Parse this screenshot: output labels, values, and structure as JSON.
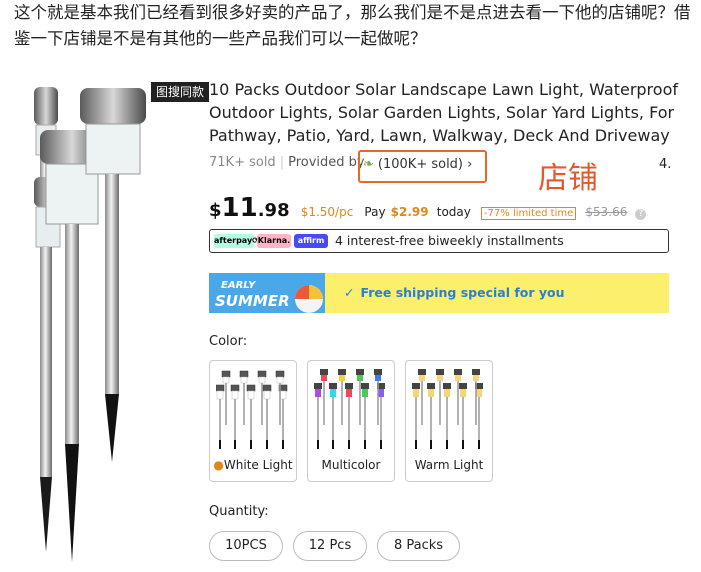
{
  "intro": {
    "text": "这个就是基本我们已经看到很多好卖的产品了，那么我们是不是点进去看一下他的店铺呢？借鉴一下店铺是不是有其他的一些产品我们可以一起做呢？"
  },
  "product": {
    "search_badge": "图搜同款",
    "title": "10 Packs Outdoor Solar Landscape Lawn Light, Waterproof Outdoor Lights, Solar Garden Lights, Solar Yard Lights, For Pathway, Patio, Yard, Lawn, Walkway, Deck And Driveway",
    "sold": "71K+ sold",
    "provided_by": "Provided by",
    "store_sold": "(100K+ sold)",
    "store_chevron": "›",
    "rating_partial": "4.",
    "annotation_label": "店铺"
  },
  "price": {
    "currency": "$",
    "whole": "11",
    "cents": ".98",
    "unit_price": "$1.50/pc",
    "pay_label": "Pay",
    "pay_amount": "$2.99",
    "today": "today",
    "discount": "-77% limited time",
    "original": "$53.66",
    "info_icon": "?"
  },
  "installments": {
    "afterpay": "afterpay⟳",
    "klarna": "Klarna.",
    "affirm": "affirm",
    "text": "4 interest-free biweekly installments"
  },
  "shipping": {
    "banner_line1": "EARLY",
    "banner_line2": "SUMMER",
    "check": "✓",
    "text": "Free shipping special for you"
  },
  "colors": {
    "label": "Color:",
    "options": [
      {
        "label": "White Light",
        "icon": "flame-icon"
      },
      {
        "label": "Multicolor"
      },
      {
        "label": "Warm Light"
      }
    ]
  },
  "quantity": {
    "label": "Quantity:",
    "options": [
      "10PCS",
      "12 Pcs",
      "8 Packs"
    ]
  },
  "theme": {
    "accent_orange": "#e0861a",
    "annotation_red": "#e25a2c",
    "shipping_bg": "#fbef6c",
    "shipping_text": "#2a7fd4"
  }
}
